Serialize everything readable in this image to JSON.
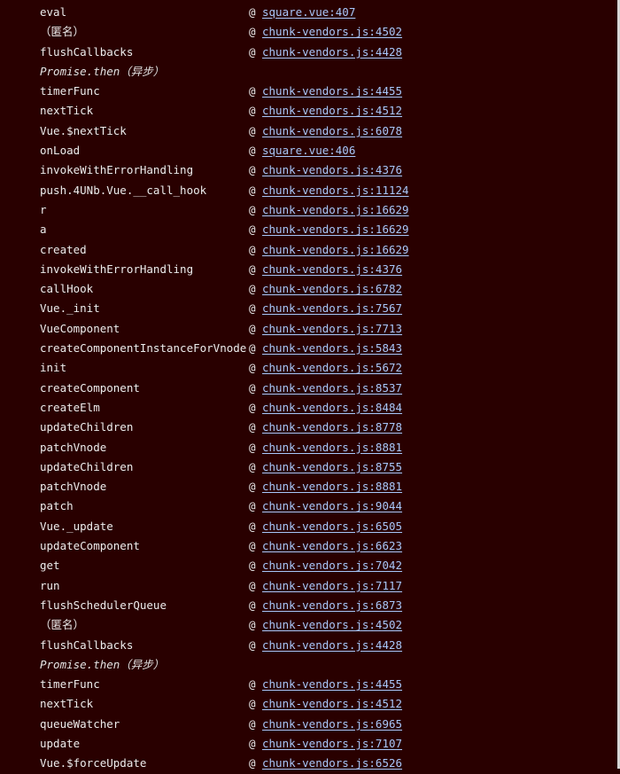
{
  "call_stack": [
    {
      "fn": "eval",
      "at": "@",
      "src": "square.vue:407",
      "async": false
    },
    {
      "fn": "（匿名）",
      "at": "@",
      "src": "chunk-vendors.js:4502",
      "async": false
    },
    {
      "fn": "flushCallbacks",
      "at": "@",
      "src": "chunk-vendors.js:4428",
      "async": false
    },
    {
      "fn": "Promise.then（异步）",
      "at": "",
      "src": "",
      "async": true
    },
    {
      "fn": "timerFunc",
      "at": "@",
      "src": "chunk-vendors.js:4455",
      "async": false
    },
    {
      "fn": "nextTick",
      "at": "@",
      "src": "chunk-vendors.js:4512",
      "async": false
    },
    {
      "fn": "Vue.$nextTick",
      "at": "@",
      "src": "chunk-vendors.js:6078",
      "async": false
    },
    {
      "fn": "onLoad",
      "at": "@",
      "src": "square.vue:406",
      "async": false
    },
    {
      "fn": "invokeWithErrorHandling",
      "at": "@",
      "src": "chunk-vendors.js:4376",
      "async": false
    },
    {
      "fn": "push.4UNb.Vue.__call_hook",
      "at": "@",
      "src": "chunk-vendors.js:11124",
      "async": false
    },
    {
      "fn": "r",
      "at": "@",
      "src": "chunk-vendors.js:16629",
      "async": false
    },
    {
      "fn": "a",
      "at": "@",
      "src": "chunk-vendors.js:16629",
      "async": false
    },
    {
      "fn": "created",
      "at": "@",
      "src": "chunk-vendors.js:16629",
      "async": false
    },
    {
      "fn": "invokeWithErrorHandling",
      "at": "@",
      "src": "chunk-vendors.js:4376",
      "async": false
    },
    {
      "fn": "callHook",
      "at": "@",
      "src": "chunk-vendors.js:6782",
      "async": false
    },
    {
      "fn": "Vue._init",
      "at": "@",
      "src": "chunk-vendors.js:7567",
      "async": false
    },
    {
      "fn": "VueComponent",
      "at": "@",
      "src": "chunk-vendors.js:7713",
      "async": false
    },
    {
      "fn": "createComponentInstanceForVnode",
      "at": "@",
      "src": "chunk-vendors.js:5843",
      "async": false
    },
    {
      "fn": "init",
      "at": "@",
      "src": "chunk-vendors.js:5672",
      "async": false
    },
    {
      "fn": "createComponent",
      "at": "@",
      "src": "chunk-vendors.js:8537",
      "async": false
    },
    {
      "fn": "createElm",
      "at": "@",
      "src": "chunk-vendors.js:8484",
      "async": false
    },
    {
      "fn": "updateChildren",
      "at": "@",
      "src": "chunk-vendors.js:8778",
      "async": false
    },
    {
      "fn": "patchVnode",
      "at": "@",
      "src": "chunk-vendors.js:8881",
      "async": false
    },
    {
      "fn": "updateChildren",
      "at": "@",
      "src": "chunk-vendors.js:8755",
      "async": false
    },
    {
      "fn": "patchVnode",
      "at": "@",
      "src": "chunk-vendors.js:8881",
      "async": false
    },
    {
      "fn": "patch",
      "at": "@",
      "src": "chunk-vendors.js:9044",
      "async": false
    },
    {
      "fn": "Vue._update",
      "at": "@",
      "src": "chunk-vendors.js:6505",
      "async": false
    },
    {
      "fn": "updateComponent",
      "at": "@",
      "src": "chunk-vendors.js:6623",
      "async": false
    },
    {
      "fn": "get",
      "at": "@",
      "src": "chunk-vendors.js:7042",
      "async": false
    },
    {
      "fn": "run",
      "at": "@",
      "src": "chunk-vendors.js:7117",
      "async": false
    },
    {
      "fn": "flushSchedulerQueue",
      "at": "@",
      "src": "chunk-vendors.js:6873",
      "async": false
    },
    {
      "fn": "（匿名）",
      "at": "@",
      "src": "chunk-vendors.js:4502",
      "async": false
    },
    {
      "fn": "flushCallbacks",
      "at": "@",
      "src": "chunk-vendors.js:4428",
      "async": false
    },
    {
      "fn": "Promise.then（异步）",
      "at": "",
      "src": "",
      "async": true
    },
    {
      "fn": "timerFunc",
      "at": "@",
      "src": "chunk-vendors.js:4455",
      "async": false
    },
    {
      "fn": "nextTick",
      "at": "@",
      "src": "chunk-vendors.js:4512",
      "async": false
    },
    {
      "fn": "queueWatcher",
      "at": "@",
      "src": "chunk-vendors.js:6965",
      "async": false
    },
    {
      "fn": "update",
      "at": "@",
      "src": "chunk-vendors.js:7107",
      "async": false
    },
    {
      "fn": "Vue.$forceUpdate",
      "at": "@",
      "src": "chunk-vendors.js:6526",
      "async": false
    }
  ]
}
